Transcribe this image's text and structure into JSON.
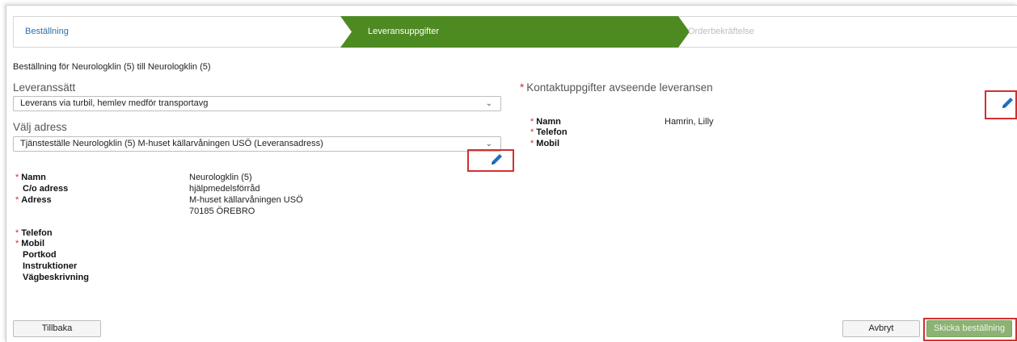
{
  "steps": {
    "step1": "Beställning",
    "step2": "Leveransuppgifter",
    "step3": "Orderbekräftelse"
  },
  "order_title": "Beställning för Neurologklin (5) till Neurologklin (5)",
  "delivery": {
    "method_label": "Leveranssätt",
    "method_value": "Leverans via turbil, hemlev medför transportavg",
    "address_label": "Välj adress",
    "address_value": "Tjänsteställe Neurologklin (5) M-huset källarvåningen USÖ (Leveransadress)"
  },
  "address_fields": {
    "name_label": "Namn",
    "name_value": "Neurologklin (5)",
    "co_label": "C/o adress",
    "co_value": "hjälpmedelsförråd",
    "address_label": "Adress",
    "address_line1": "M-huset källarvåningen USÖ",
    "address_line2": "70185 ÖREBRO",
    "phone_label": "Telefon",
    "mobile_label": "Mobil",
    "portcode_label": "Portkod",
    "instructions_label": "Instruktioner",
    "directions_label": "Vägbeskrivning"
  },
  "contact": {
    "title": "Kontaktuppgifter avseende leveransen",
    "name_label": "Namn",
    "name_value": "Hamrin, Lilly",
    "phone_label": "Telefon",
    "mobile_label": "Mobil"
  },
  "required_mark": "*",
  "chevron": "⌄",
  "buttons": {
    "back": "Tillbaka",
    "cancel": "Avbryt",
    "submit": "Skicka beställning"
  },
  "colors": {
    "active_step": "#4e8a22",
    "link": "#2e6ea6",
    "required": "#d32f2f",
    "highlight": "#d32f2f",
    "submit": "#8cb374"
  }
}
